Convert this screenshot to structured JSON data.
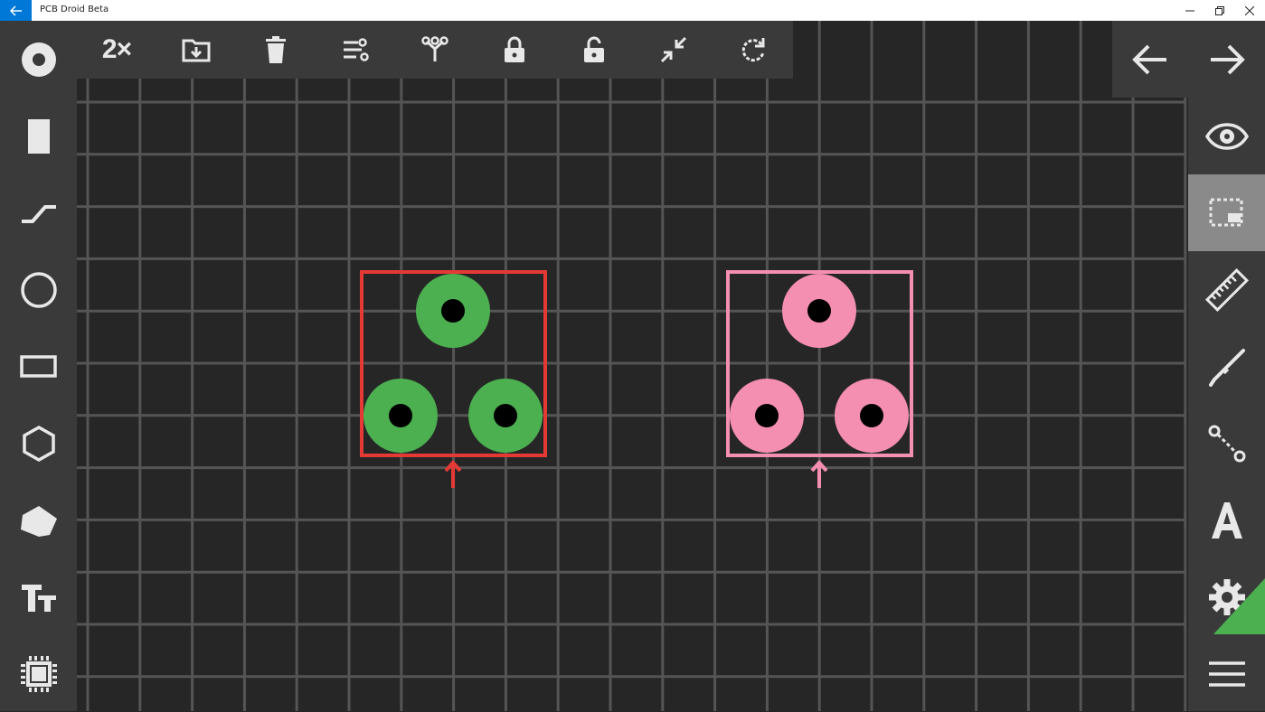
{
  "window": {
    "title": "PCB Droid Beta",
    "controls": [
      "minimize",
      "restore",
      "close"
    ]
  },
  "left_toolbar": {
    "tools": [
      {
        "name": "pad-tool",
        "icon": "ring-pad-icon"
      },
      {
        "name": "smd-pad-tool",
        "icon": "rect-pad-icon"
      },
      {
        "name": "track-tool",
        "icon": "track-icon"
      },
      {
        "name": "circle-tool",
        "icon": "circle-icon"
      },
      {
        "name": "rectangle-tool",
        "icon": "rectangle-icon"
      },
      {
        "name": "polygon-tool",
        "icon": "hexagon-icon"
      },
      {
        "name": "fill-polygon-tool",
        "icon": "filled-polygon-icon"
      },
      {
        "name": "text-tool",
        "icon": "text-size-icon"
      },
      {
        "name": "component-tool",
        "icon": "chip-icon"
      }
    ]
  },
  "top_toolbar": {
    "zoom_label": "2×",
    "tools": [
      "zoom-icon",
      "save-to-library-icon",
      "delete-icon",
      "align-icon",
      "distribute-icon",
      "lock-icon",
      "unlock-icon",
      "merge-icon",
      "rotate-icon"
    ]
  },
  "right_toolbar": {
    "tools": [
      {
        "name": "visibility-tool",
        "icon": "eye-icon"
      },
      {
        "name": "select-tool",
        "icon": "selection-icon",
        "active": true
      },
      {
        "name": "measure-tool",
        "icon": "ruler-icon"
      },
      {
        "name": "pen-tool",
        "icon": "pen-icon"
      },
      {
        "name": "connect-tool",
        "icon": "connection-icon"
      },
      {
        "name": "font-tool",
        "icon": "font-a-icon"
      },
      {
        "name": "settings-tool",
        "icon": "gear-icon"
      },
      {
        "name": "menu-tool",
        "icon": "hamburger-icon"
      }
    ]
  },
  "navigation": {
    "undo": "arrow-left-icon",
    "redo": "arrow-right-icon"
  },
  "board": {
    "components": [
      {
        "name": "component-green",
        "outline_color": "#e53935",
        "pad_color": "#4caf50",
        "pad_count": 3
      },
      {
        "name": "component-pink",
        "outline_color": "#f48fb1",
        "pad_color": "#f48fb1",
        "pad_count": 3
      }
    ],
    "grid_color": "#555555",
    "background": "#262626"
  },
  "colors": {
    "accent": "#0078d7",
    "toolbar": "#3a3a3a",
    "active_tool": "#8a8a8a",
    "icon": "#e8e8e8"
  }
}
